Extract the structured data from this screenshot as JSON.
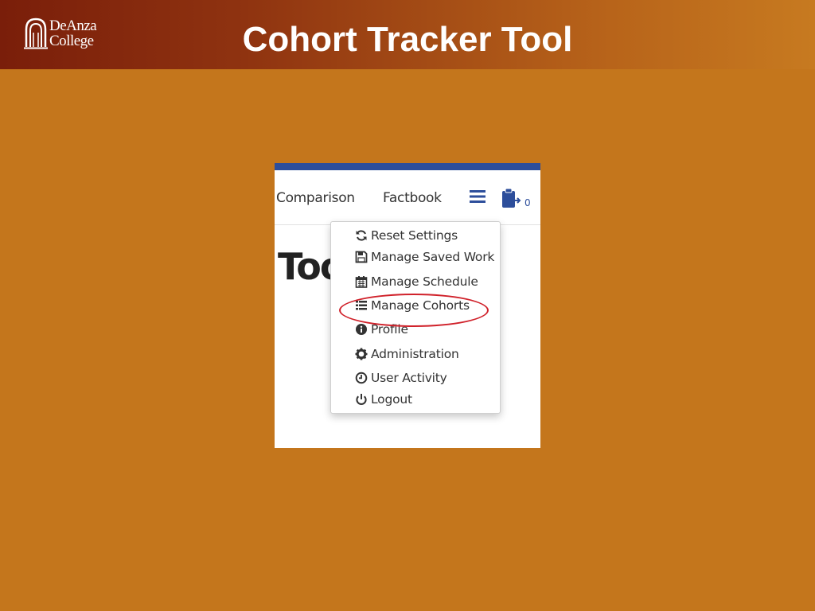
{
  "slide": {
    "title": "Cohort Tracker Tool",
    "logo": {
      "line1": "DeAnza",
      "line2": "College"
    }
  },
  "navbar": {
    "links": [
      "Comparison",
      "Factbook"
    ],
    "cart_count": "0",
    "accent_color": "#2d4e9b"
  },
  "page": {
    "heading_partial": "Too"
  },
  "dropdown": {
    "items": [
      {
        "label": "Reset Settings",
        "icon": "refresh-icon"
      },
      {
        "label": "Manage Saved Work",
        "icon": "floppy-disk-icon"
      },
      {
        "label": "Manage Schedule",
        "icon": "calendar-icon"
      },
      {
        "label": "Manage Cohorts",
        "icon": "list-icon",
        "highlighted": true
      },
      {
        "label": "Profile",
        "icon": "info-circle-icon"
      },
      {
        "label": "Administration",
        "icon": "gear-icon"
      },
      {
        "label": "User Activity",
        "icon": "clock-icon"
      },
      {
        "label": "Logout",
        "icon": "power-icon"
      }
    ],
    "highlight_color": "#d0212a"
  },
  "colors": {
    "slide_background": "#c4761c",
    "header_gradient_start": "#7a1e0a",
    "header_gradient_end": "#c77a20"
  }
}
